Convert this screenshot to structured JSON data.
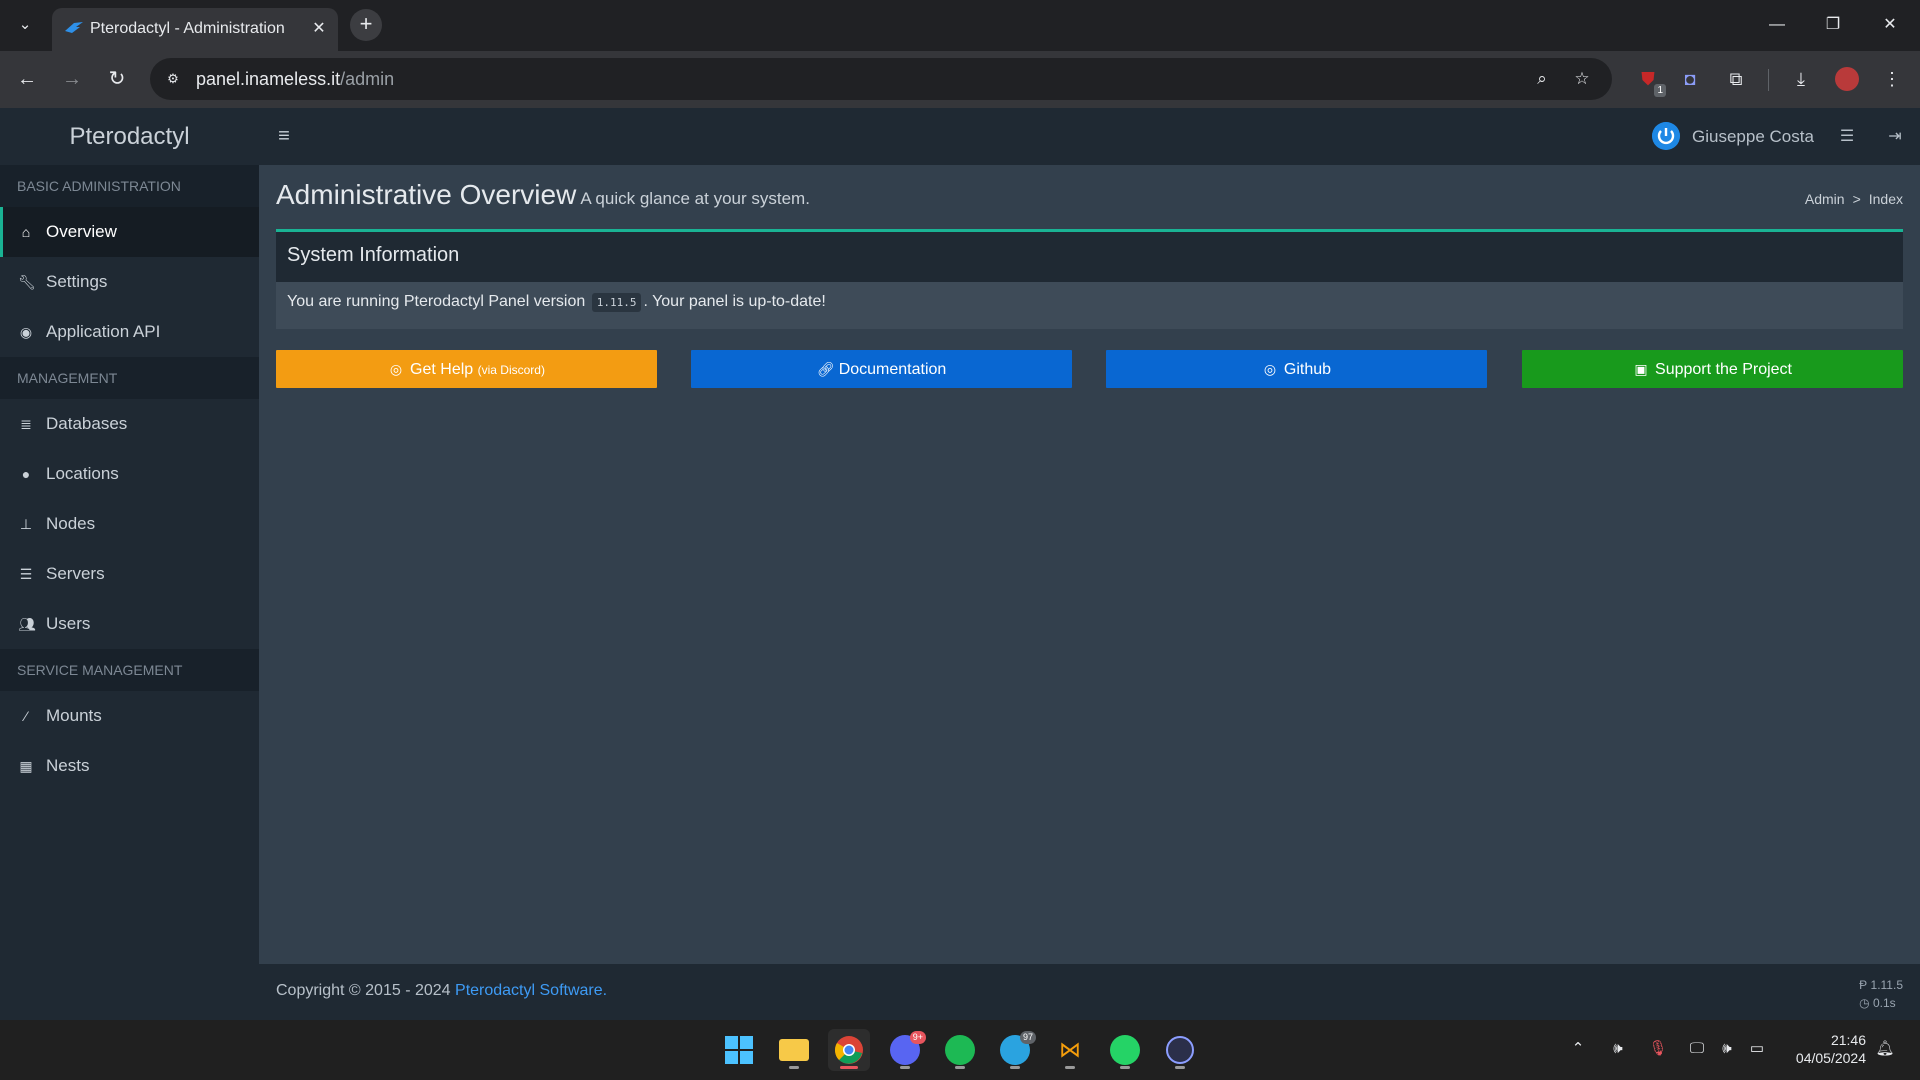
{
  "browser": {
    "tab_title": "Pterodactyl - Administration",
    "url_host": "panel.inameless.it",
    "url_path": "/admin",
    "extension_badge": "1"
  },
  "header": {
    "brand": "Pterodactyl",
    "user_name": "Giuseppe Costa"
  },
  "sidebar": {
    "sections": [
      {
        "title": "Basic Administration",
        "items": [
          {
            "label": "Overview",
            "icon": "home-icon",
            "active": true
          },
          {
            "label": "Settings",
            "icon": "wrench-icon"
          },
          {
            "label": "Application API",
            "icon": "gamepad-icon"
          }
        ]
      },
      {
        "title": "Management",
        "items": [
          {
            "label": "Databases",
            "icon": "database-icon"
          },
          {
            "label": "Locations",
            "icon": "globe-icon"
          },
          {
            "label": "Nodes",
            "icon": "sitemap-icon"
          },
          {
            "label": "Servers",
            "icon": "server-icon"
          },
          {
            "label": "Users",
            "icon": "users-icon"
          }
        ]
      },
      {
        "title": "Service Management",
        "items": [
          {
            "label": "Mounts",
            "icon": "magic-icon"
          },
          {
            "label": "Nests",
            "icon": "th-large-icon"
          }
        ]
      }
    ]
  },
  "page": {
    "title": "Administrative Overview",
    "subtitle": "A quick glance at your system.",
    "breadcrumb": [
      "Admin",
      "Index"
    ]
  },
  "system_info": {
    "title": "System Information",
    "text_before": "You are running Pterodactyl Panel version",
    "version": "1.11.5",
    "text_after": ". Your panel is up-to-date!"
  },
  "actions": {
    "get_help": "Get Help",
    "get_help_small": "(via Discord)",
    "documentation": "Documentation",
    "github": "Github",
    "support": "Support the Project"
  },
  "footer": {
    "copyright": "Copyright © 2015 - 2024",
    "link_text": "Pterodactyl Software.",
    "version": "1.11.5",
    "time": "0.1s"
  },
  "taskbar": {
    "discord_badge": "9+",
    "telegram_badge": "97",
    "time": "21:46",
    "date": "04/05/2024"
  },
  "colors": {
    "accent": "#1ab394",
    "warning": "#f39c12",
    "primary": "#0967d2",
    "success": "#189a1c"
  }
}
